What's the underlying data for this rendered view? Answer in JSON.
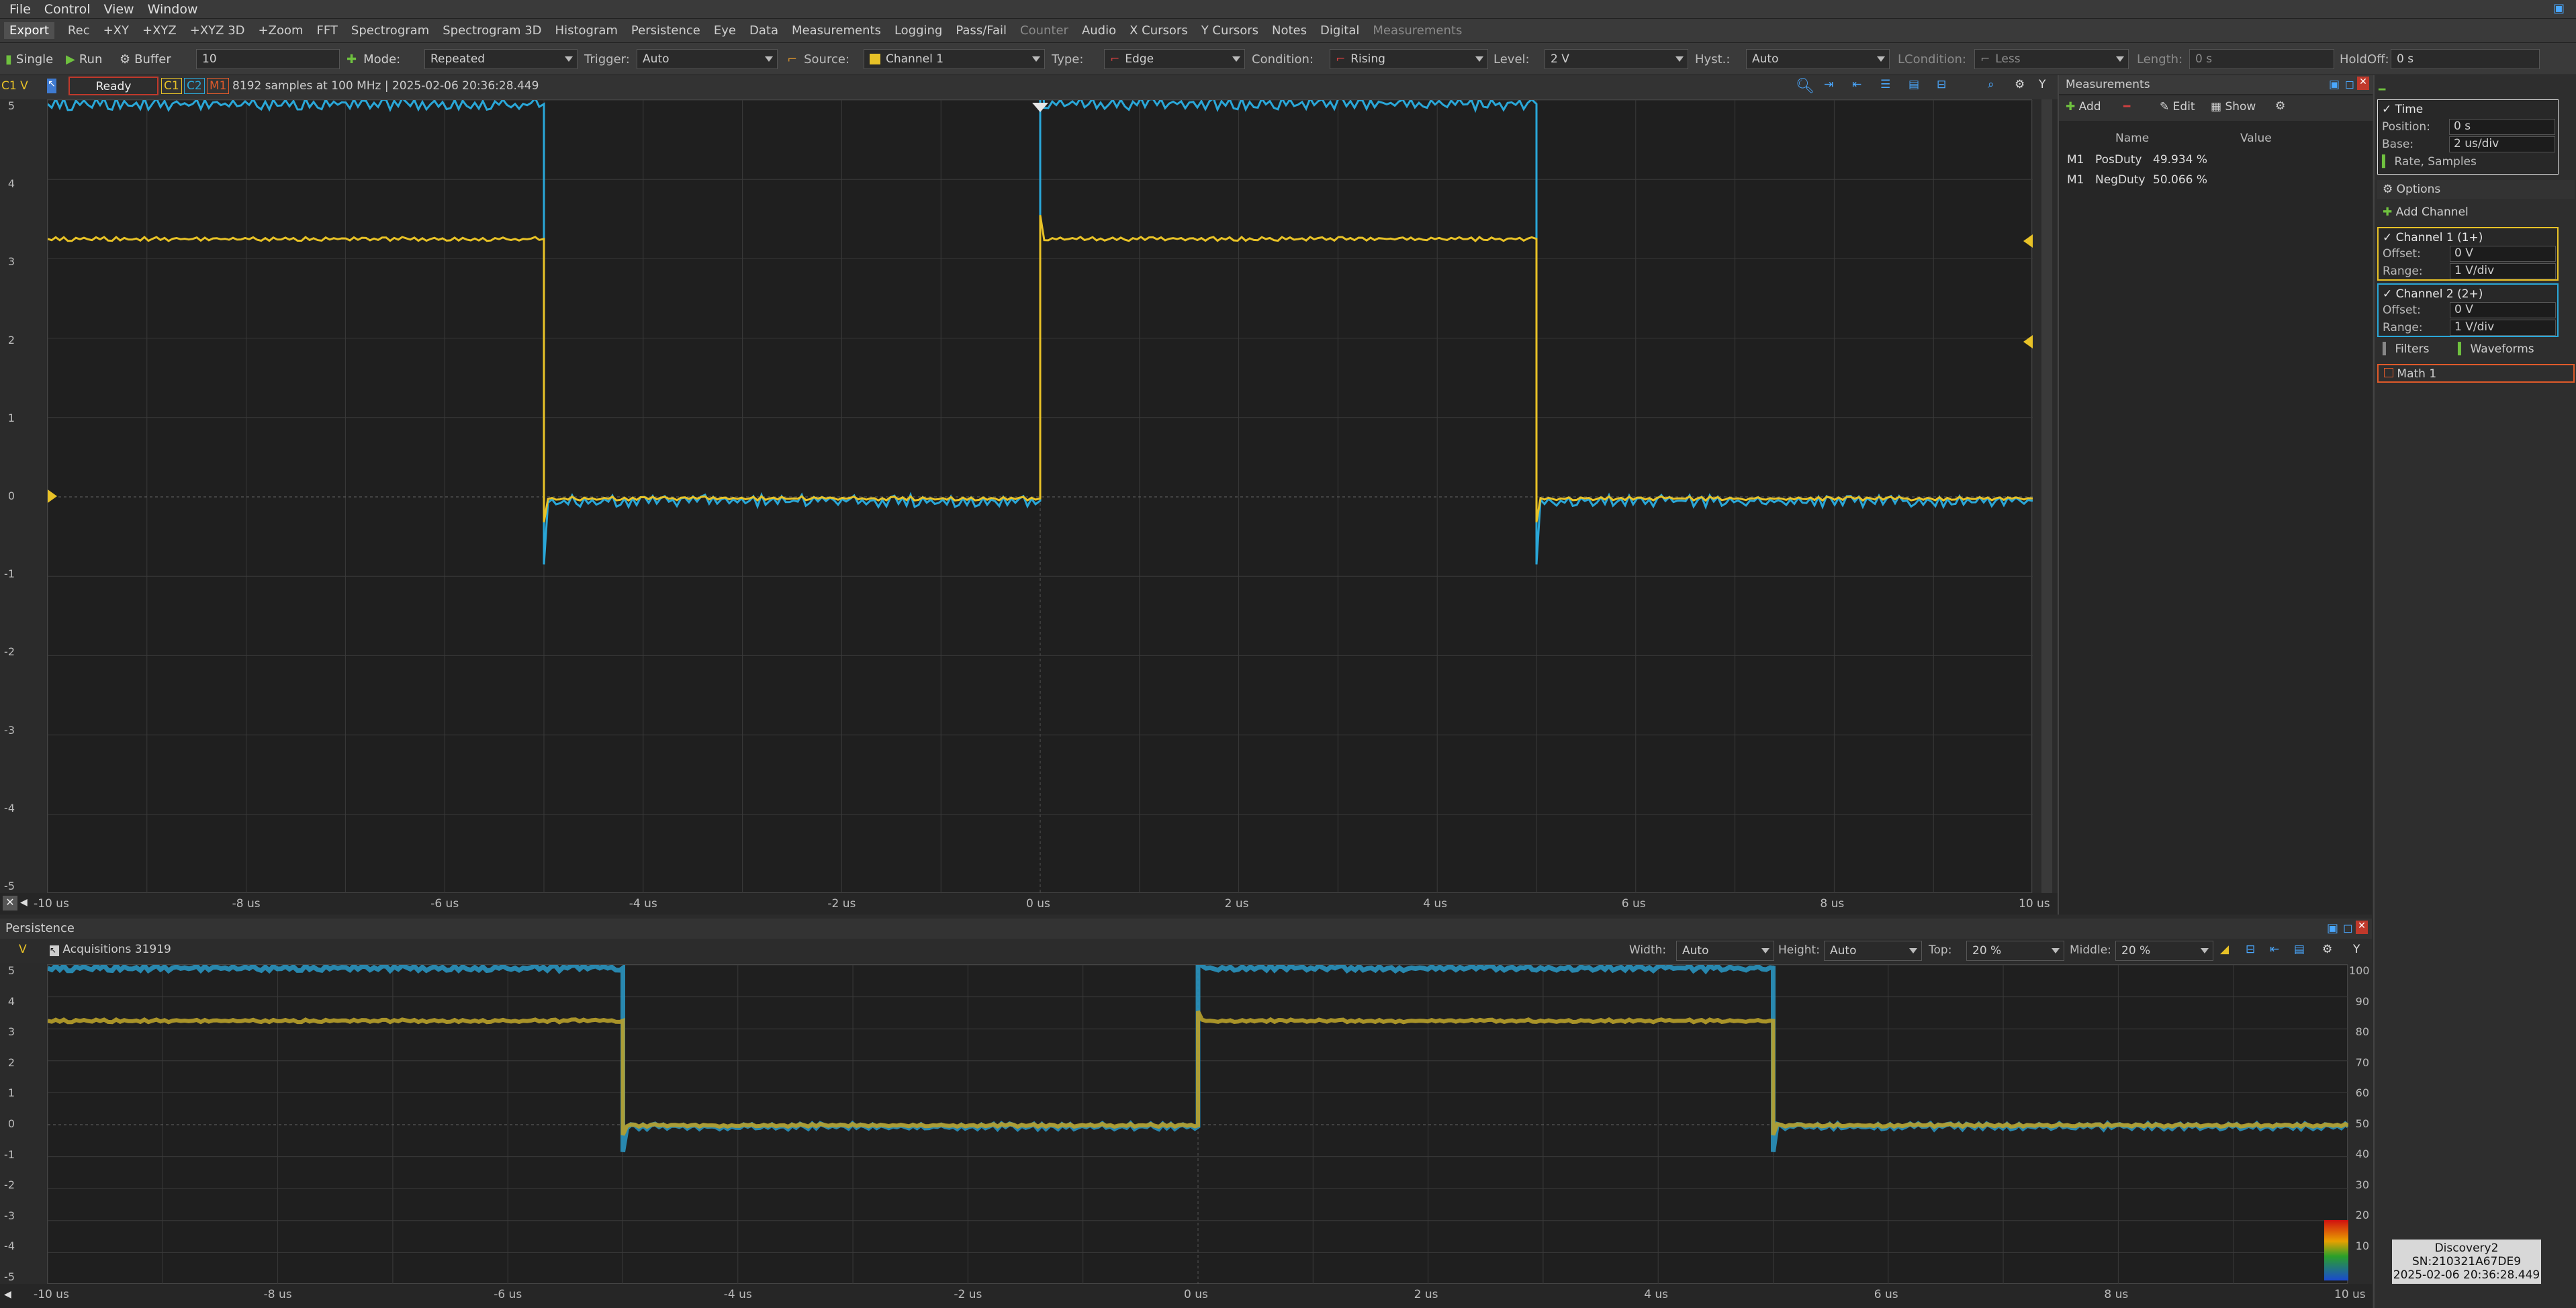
{
  "menu": {
    "file": "File",
    "control": "Control",
    "view": "View",
    "window": "Window"
  },
  "views": [
    "Export",
    "Rec",
    "+XY",
    "+XYZ",
    "+XYZ 3D",
    "+Zoom",
    "FFT",
    "Spectrogram",
    "Spectrogram 3D",
    "Histogram",
    "Persistence",
    "Eye",
    "Data",
    "Measurements",
    "Logging",
    "Pass/Fail",
    "Counter",
    "Audio",
    "X Cursors",
    "Y Cursors",
    "Notes",
    "Digital",
    "Measurements"
  ],
  "control": {
    "single": "Single",
    "run": "Run",
    "buffer_label": "Buffer",
    "buffer_value": "10",
    "mode_label": "Mode:",
    "mode_value": "Repeated",
    "trigger_label": "Trigger:",
    "trigger_value": "Auto",
    "source_label": "Source:",
    "source_value": "Channel 1",
    "type_label": "Type:",
    "type_value": "Edge",
    "condition_label": "Condition:",
    "condition_value": "Rising",
    "level_label": "Level:",
    "level_value": "2 V",
    "hyst_label": "Hyst.:",
    "hyst_value": "Auto",
    "lcondition_label": "LCondition:",
    "lcondition_value": "Less",
    "length_label": "Length:",
    "length_value": "0 s",
    "holdoff_label": "HoldOff:",
    "holdoff_value": "0 s"
  },
  "scope": {
    "axis_label": "C1 V",
    "status": "Ready",
    "c1": "C1",
    "c2": "C2",
    "m1": "M1",
    "info": "8192 samples at 100 MHz | 2025-02-06 20:36:28.449",
    "y_ticks": [
      "5",
      "4",
      "3",
      "2",
      "1",
      "0",
      "-1",
      "-2",
      "-3",
      "-4",
      "-5"
    ],
    "x_ticks": [
      "-10 us",
      "-8 us",
      "-6 us",
      "-4 us",
      "-2 us",
      "0 us",
      "2 us",
      "4 us",
      "6 us",
      "8 us",
      "10 us"
    ]
  },
  "measurements": {
    "title": "Measurements",
    "add": "Add",
    "edit": "Edit",
    "show": "Show",
    "col_name": "Name",
    "col_value": "Value",
    "rows": [
      {
        "ch": "M1",
        "name": "PosDuty",
        "value": "49.934 %"
      },
      {
        "ch": "M1",
        "name": "NegDuty",
        "value": "50.066 %"
      }
    ]
  },
  "sidebar": {
    "time_title": "Time",
    "position_label": "Position:",
    "position_value": "0 s",
    "base_label": "Base:",
    "base_value": "2 us/div",
    "rate": "Rate, Samples",
    "options": "Options",
    "add_channel": "Add Channel",
    "ch1_title": "Channel 1 (1+)",
    "ch1_offset_label": "Offset:",
    "ch1_offset": "0 V",
    "ch1_range_label": "Range:",
    "ch1_range": "1 V/div",
    "ch2_title": "Channel 2 (2+)",
    "ch2_offset_label": "Offset:",
    "ch2_offset": "0 V",
    "ch2_range_label": "Range:",
    "ch2_range": "1 V/div",
    "filters": "Filters",
    "waveforms": "Waveforms",
    "math1": "Math 1"
  },
  "persistence": {
    "title": "Persistence",
    "v": "V",
    "acquisitions": "Acquisitions 31919",
    "width_label": "Width:",
    "width_value": "Auto",
    "height_label": "Height:",
    "height_value": "Auto",
    "top_label": "Top:",
    "top_value": "20 %",
    "middle_label": "Middle:",
    "middle_value": "20 %",
    "y_ticks": [
      "5",
      "4",
      "3",
      "2",
      "1",
      "0",
      "-1",
      "-2",
      "-3",
      "-4",
      "-5"
    ],
    "right_ticks": [
      "100",
      "90",
      "80",
      "70",
      "60",
      "50",
      "40",
      "30",
      "20",
      "10"
    ],
    "x_ticks": [
      "-10 us",
      "-8 us",
      "-6 us",
      "-4 us",
      "-2 us",
      "0 us",
      "2 us",
      "4 us",
      "6 us",
      "8 us",
      "10 us"
    ]
  },
  "device": {
    "name": "Discovery2",
    "serial": "SN:210321A67DE9",
    "time": "2025-02-06 20:36:28.449"
  },
  "colors": {
    "ch1": "#e8c227",
    "ch2": "#2aa7d8",
    "m1": "#e05a2a",
    "grid": "#3c3c3c"
  }
}
